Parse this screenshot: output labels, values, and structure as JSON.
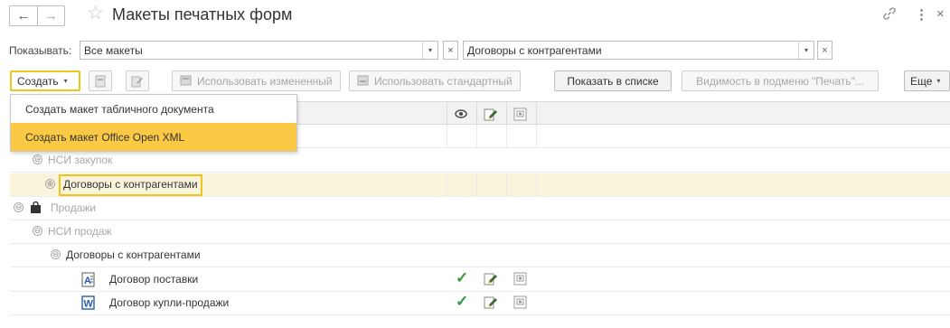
{
  "window": {
    "title": "Макеты печатных форм",
    "nav_back_icon": "←",
    "nav_forward_icon": "→",
    "favorite_icon": "☆",
    "link_icon": "🔗",
    "more_icon": "⋮",
    "close_icon": "×"
  },
  "filter": {
    "label": "Показывать:",
    "show_value": "Все макеты",
    "object_value": "Договоры с контрагентами",
    "arrow": "▾",
    "clear": "×"
  },
  "toolbar": {
    "create_label": "Создать",
    "create_arrow": "▾",
    "use_modified_label": "Использовать измененный",
    "use_standard_label": "Использовать стандартный",
    "show_in_list_label": "Показать в списке",
    "print_visibility_label": "Видимость в подменю \"Печать\"...",
    "more_label": "Еще",
    "more_arrow": "▾"
  },
  "create_menu": {
    "items": [
      {
        "label": "Создать макет табличного документа"
      },
      {
        "label": "Создать макет Office Open XML"
      }
    ]
  },
  "table": {
    "rows": [
      {
        "text": "НСИ закупок",
        "expander": "⊖"
      },
      {
        "text": "Договоры с контрагентами",
        "expander": "⊕"
      },
      {
        "text": "Продажи",
        "expander": "⊖"
      },
      {
        "text": "НСИ продаж",
        "expander": "⊖"
      },
      {
        "text": "Договоры с контрагентами",
        "expander": "⊖"
      },
      {
        "text": "Договор поставки",
        "checked": "✓"
      },
      {
        "text": "Договор купли-продажи",
        "checked": "✓"
      }
    ],
    "word_doc_letter": "W",
    "spreadsheet_doc_letter": "A"
  },
  "colors": {
    "accent": "#f0c419",
    "menu_highlight": "#fbc943",
    "selected_row": "#fbf4dc",
    "check_green": "#2e9e3e"
  }
}
